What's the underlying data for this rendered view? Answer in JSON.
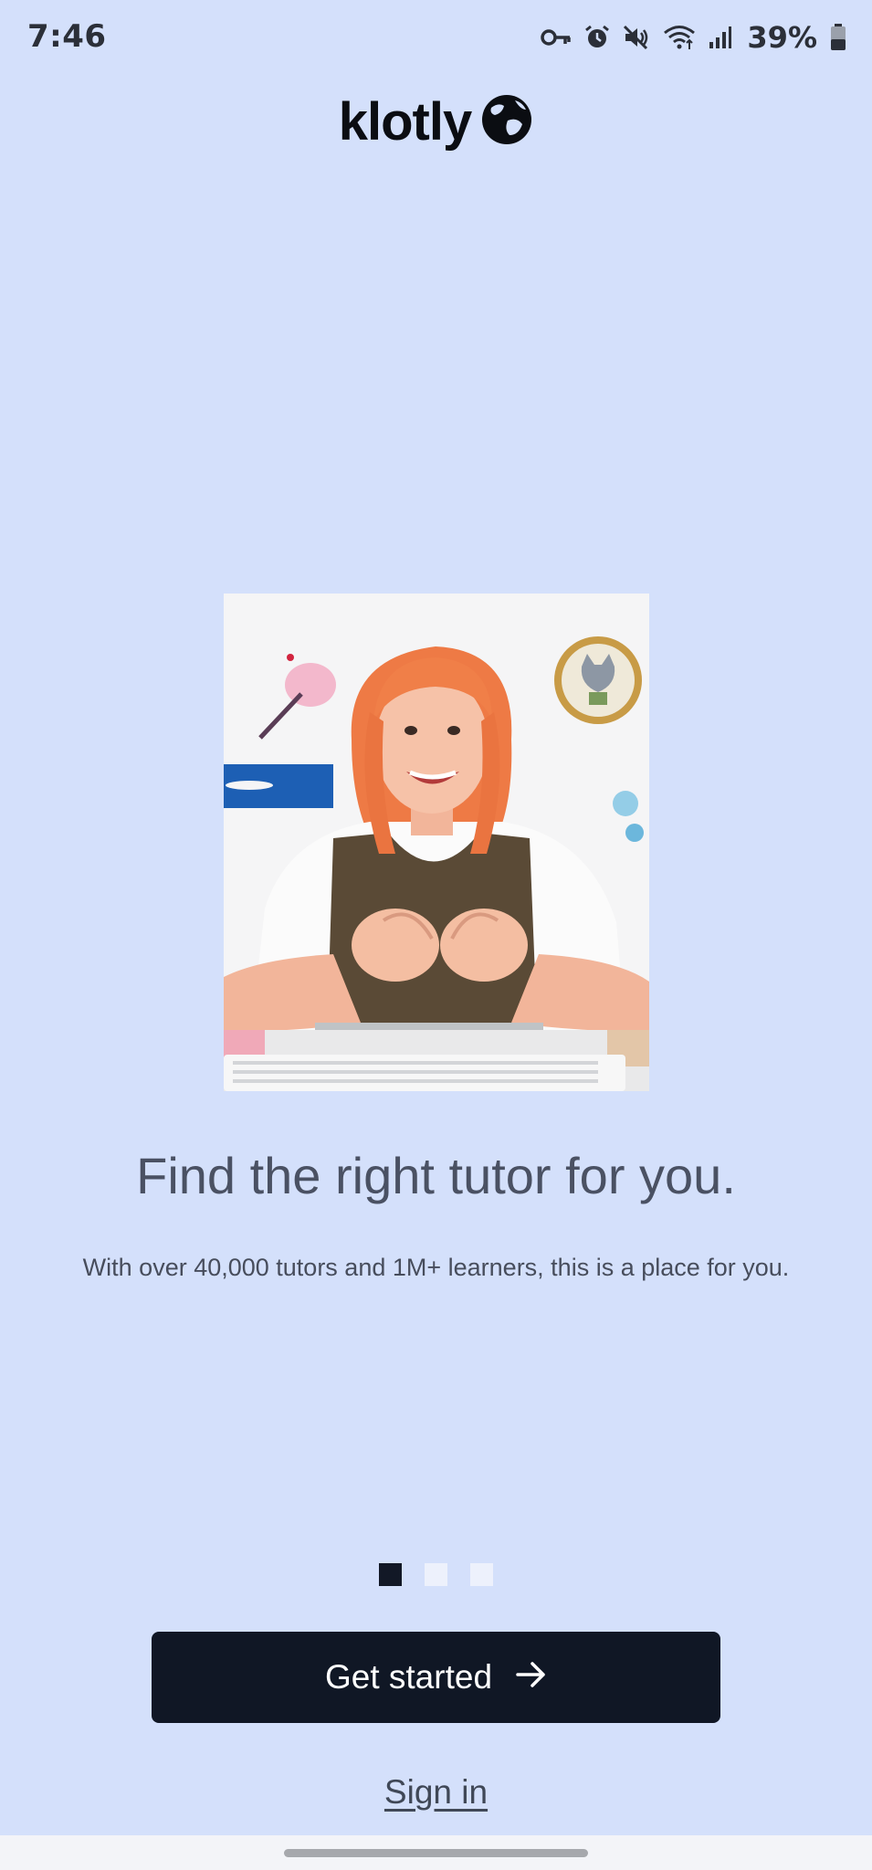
{
  "status_bar": {
    "time": "7:46",
    "battery": "39%",
    "icons": [
      "vpn-key-icon",
      "alarm-icon",
      "mute-icon",
      "wifi-icon",
      "signal-icon",
      "battery-icon"
    ]
  },
  "brand": {
    "name": "klotly",
    "logo_icon": "globe-icon",
    "color": "#0b0d12"
  },
  "hero": {
    "image": "tutor-photo"
  },
  "onboarding": {
    "headline": "Find the right tutor for you.",
    "subhead": "With over 40,000 tutors and 1M+ learners, this is a place for you.",
    "page_index": 1,
    "page_count": 3
  },
  "actions": {
    "get_started_label": "Get started",
    "get_started_icon": "arrow-right-icon",
    "sign_in_label": "Sign in"
  },
  "colors": {
    "background": "#d4e0fb",
    "button": "#101725",
    "dot_active": "#121826",
    "dot_inactive": "#edf1fc"
  }
}
